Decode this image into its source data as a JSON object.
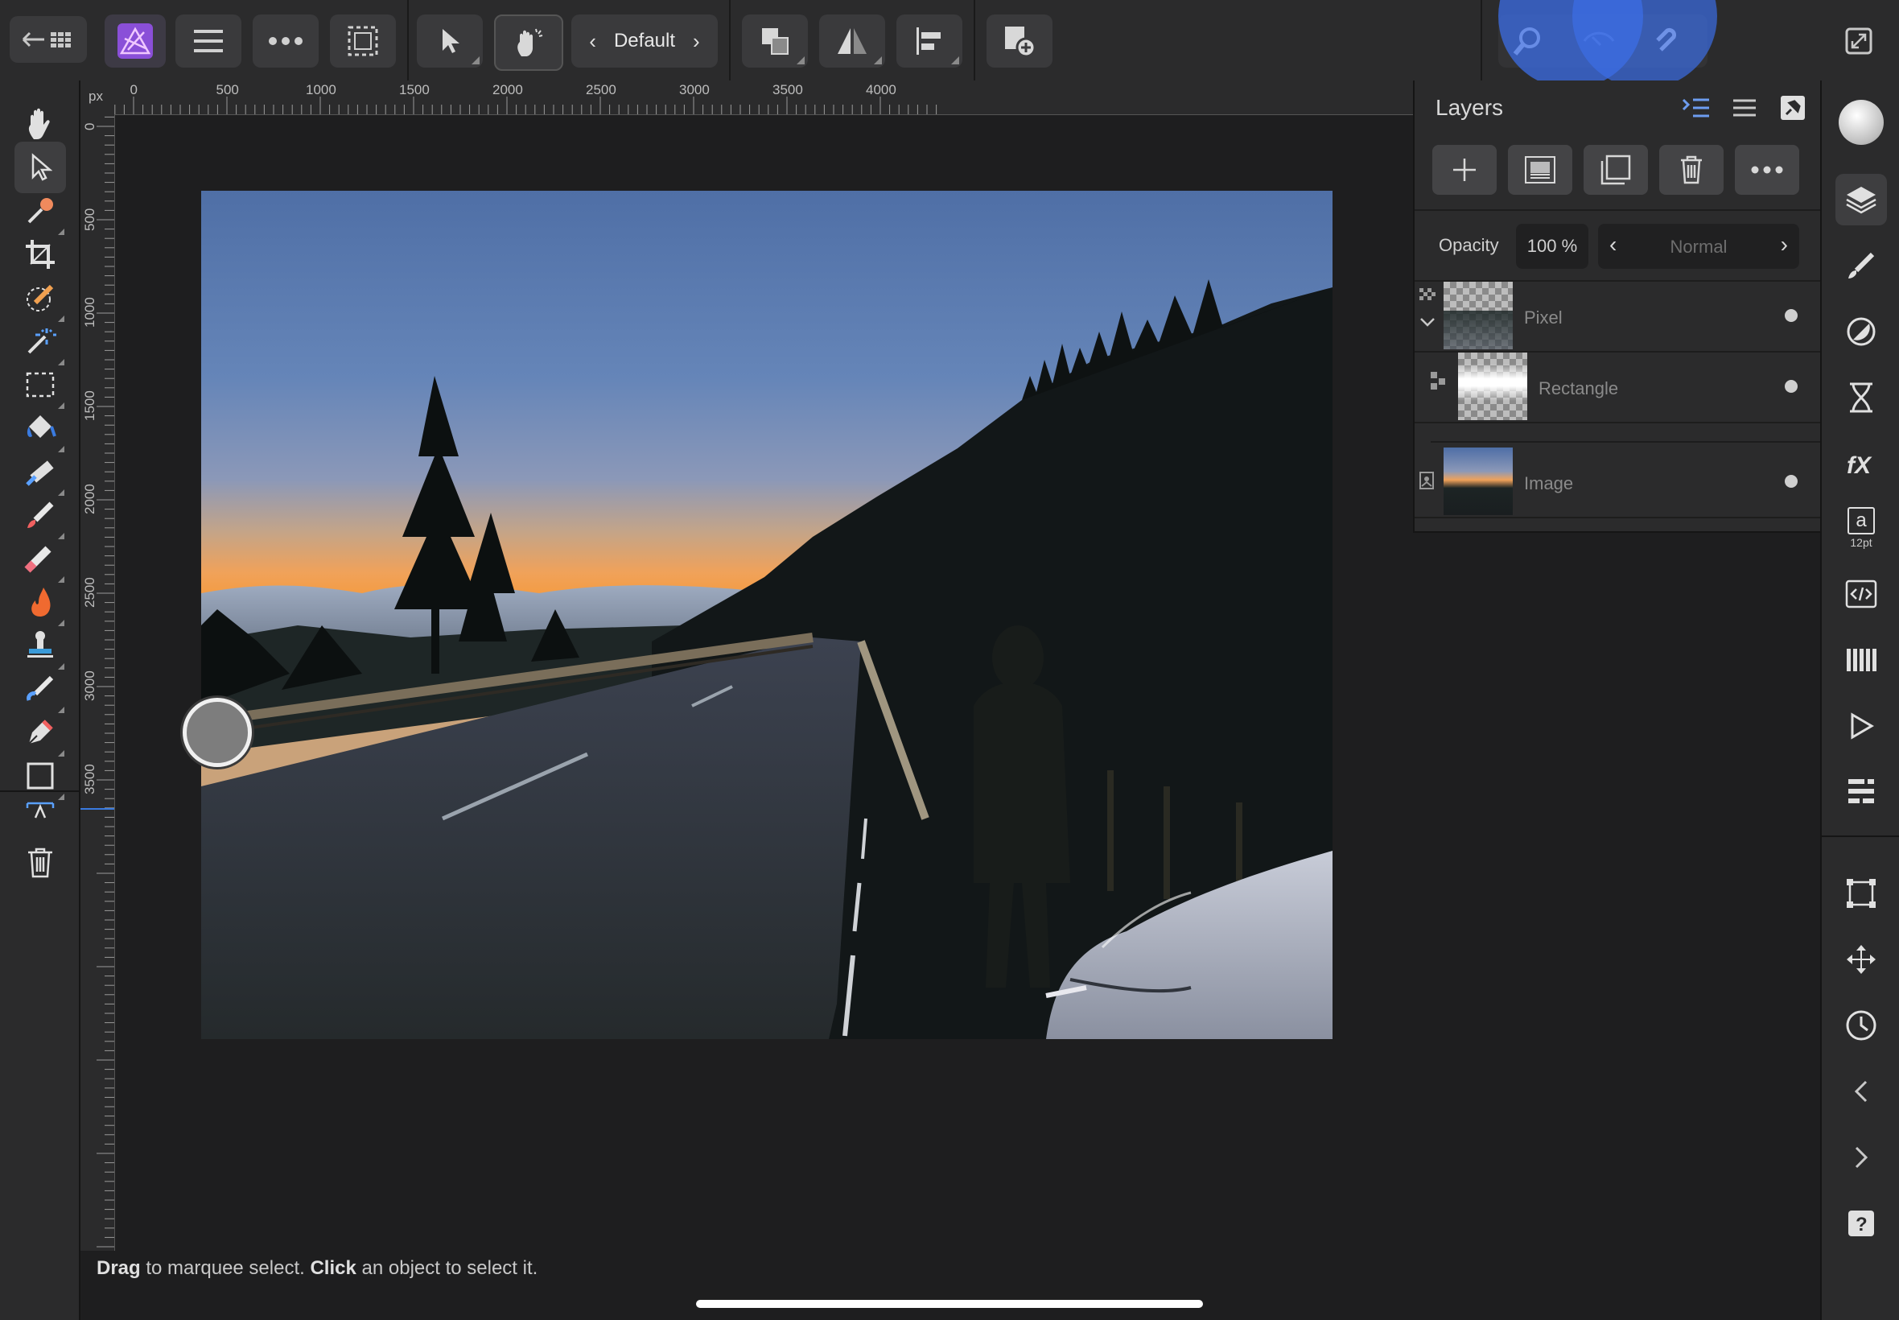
{
  "toolbar": {
    "persona_name": "Default",
    "buttons": [
      "back-to-documents",
      "menu",
      "more",
      "selection",
      "move",
      "touch-gesture",
      "arrange",
      "flip",
      "align",
      "add-document"
    ]
  },
  "rulers": {
    "unit": "px",
    "top_labels": [
      "0",
      "500",
      "1000",
      "1500",
      "2000",
      "2500",
      "3000",
      "3500",
      "4000"
    ],
    "left_labels": [
      "0",
      "500",
      "1000",
      "1500",
      "2000",
      "2500",
      "3000",
      "3500"
    ]
  },
  "layers_panel": {
    "title": "Layers",
    "opacity_label": "Opacity",
    "opacity_value": "100 %",
    "blend_mode": "Normal",
    "layers": [
      {
        "name": "Pixel",
        "visible": true
      },
      {
        "name": "Rectangle",
        "visible": true
      },
      {
        "name": "Image",
        "visible": true
      }
    ]
  },
  "studio": {
    "text_size": "12pt",
    "text_glyph": "a"
  },
  "status": {
    "drag": "Drag",
    "drag_rest": " to marquee select. ",
    "click": "Click",
    "click_rest": " an object to select it."
  },
  "colors": {
    "accent": "#4a7bd8",
    "panel": "#2b2b2c",
    "canvas": "#1e1e1f"
  }
}
